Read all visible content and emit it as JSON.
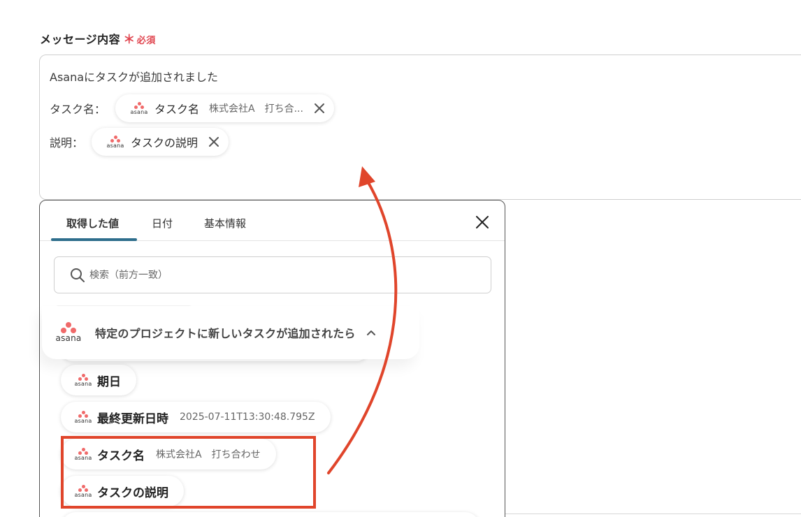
{
  "field": {
    "label": "メッセージ内容",
    "required_mark": "＊",
    "required_text": "必須"
  },
  "editor": {
    "line1": "Asanaにタスクが追加されました",
    "line2_prefix": "タスク名：",
    "line2_chip_label": "タスク名",
    "line2_chip_preview": "株式会社A　打ち合...",
    "line3_prefix": "説明：",
    "line3_chip_label": "タスクの説明",
    "chip_icon": "asana-logo-icon",
    "chip_remove_icon": "close-icon"
  },
  "asana_word": "asana",
  "popup": {
    "tabs": [
      {
        "label": "取得した値",
        "active": true
      },
      {
        "label": "日付",
        "active": false
      },
      {
        "label": "基本情報",
        "active": false
      }
    ],
    "close_icon": "close-icon",
    "search_placeholder": "検索（前方一致）",
    "search_icon": "search-icon",
    "section_title": "特定のプロジェクトに新しいタスクが追加されたら",
    "section_toggle_icon": "chevron-up-icon",
    "items": [
      {
        "label": "期日",
        "value": ""
      },
      {
        "label": "最終更新日時",
        "value": "2025-07-11T13:30:48.795Z"
      },
      {
        "label": "タスク名",
        "value": "株式会社A　打ち合わせ"
      },
      {
        "label": "タスクの説明",
        "value": ""
      }
    ]
  },
  "colors": {
    "accent_tab": "#2e6e8c",
    "required": "#e0454f",
    "highlight": "#e0452b",
    "asana": "#f06a6a"
  }
}
